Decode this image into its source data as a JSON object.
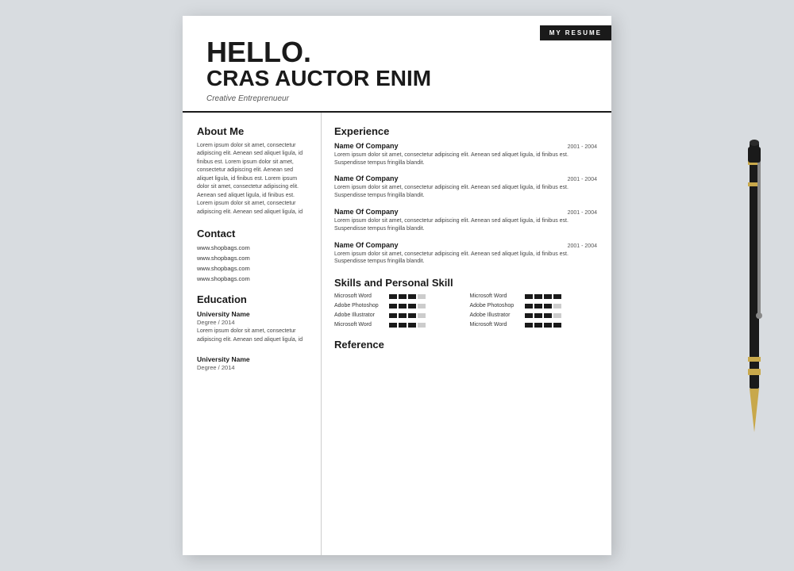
{
  "card": {
    "top_label": "MY RESUME",
    "header": {
      "hello": "HELLO.",
      "name": "CRAS AUCTOR ENIM",
      "subtitle": "Creative Entreprenueur"
    },
    "left": {
      "about": {
        "heading": "About Me",
        "text": "Lorem ipsum dolor sit amet, consectetur adipiscing elit. Aenean sed aliquet ligula, id finibus est. Lorem ipsum dolor sit amet, consectetur adipiscing elit. Aenean sed aliquet ligula, id finibus est. Lorem ipsum dolor sit amet, consectetur adipiscing elit. Aenean sed aliquet ligula, id finibus est. Lorem ipsum dolor sit amet, consectetur adipiscing elit. Aenean sed aliquet ligula, id"
      },
      "contact": {
        "heading": "Contact",
        "items": [
          "www.shopbags.com",
          "www.shopbags.com",
          "www.shopbags.com",
          "www.shopbags.com"
        ]
      },
      "education": {
        "heading": "Education",
        "entries": [
          {
            "school": "University Name",
            "degree": "Degree / 2014",
            "desc": "Lorem ipsum dolor sit amet, consectetur adipiscing elit. Aenean sed aliquet ligula, id"
          },
          {
            "school": "University Name",
            "degree": "Degree / 2014",
            "desc": ""
          }
        ]
      }
    },
    "right": {
      "experience": {
        "heading": "Experience",
        "entries": [
          {
            "company": "Name Of Company",
            "date": "2001 - 2004",
            "desc": "Lorem ipsum dolor sit amet, consectetur adipiscing elit. Aenean sed aliquet ligula, id finibus est. Suspendisse tempus fringilla blandit."
          },
          {
            "company": "Name Of Company",
            "date": "2001 - 2004",
            "desc": "Lorem ipsum dolor sit amet, consectetur adipiscing elit. Aenean sed aliquet ligula, id finibus est. Suspendisse tempus fringilla blandit."
          },
          {
            "company": "Name Of Company",
            "date": "2001 - 2004",
            "desc": "Lorem ipsum dolor sit amet, consectetur adipiscing elit. Aenean sed aliquet ligula, id finibus est. Suspendisse tempus fringilla blandit."
          },
          {
            "company": "Name Of Company",
            "date": "2001 - 2004",
            "desc": "Lorem ipsum dolor sit amet, consectetur adipiscing elit. Aenean sed aliquet ligula, id finibus est. Suspendisse tempus fringilla blandit."
          }
        ]
      },
      "skills": {
        "heading": "Skills and Personal Skill",
        "items": [
          {
            "label": "Microsoft  Word",
            "fill": 3,
            "total": 4
          },
          {
            "label": "Microsoft  Word",
            "fill": 4,
            "total": 4
          },
          {
            "label": "Adobe Photoshop",
            "fill": 3,
            "total": 4
          },
          {
            "label": "Adobe Photoshop",
            "fill": 3,
            "total": 4
          },
          {
            "label": "Adobe Illustrator",
            "fill": 3,
            "total": 4
          },
          {
            "label": "Adobe Illustrator",
            "fill": 3,
            "total": 4
          },
          {
            "label": "Microsoft  Word",
            "fill": 3,
            "total": 4
          },
          {
            "label": "Microsoft  Word",
            "fill": 4,
            "total": 4
          }
        ]
      },
      "reference": {
        "heading": "Reference"
      }
    }
  }
}
